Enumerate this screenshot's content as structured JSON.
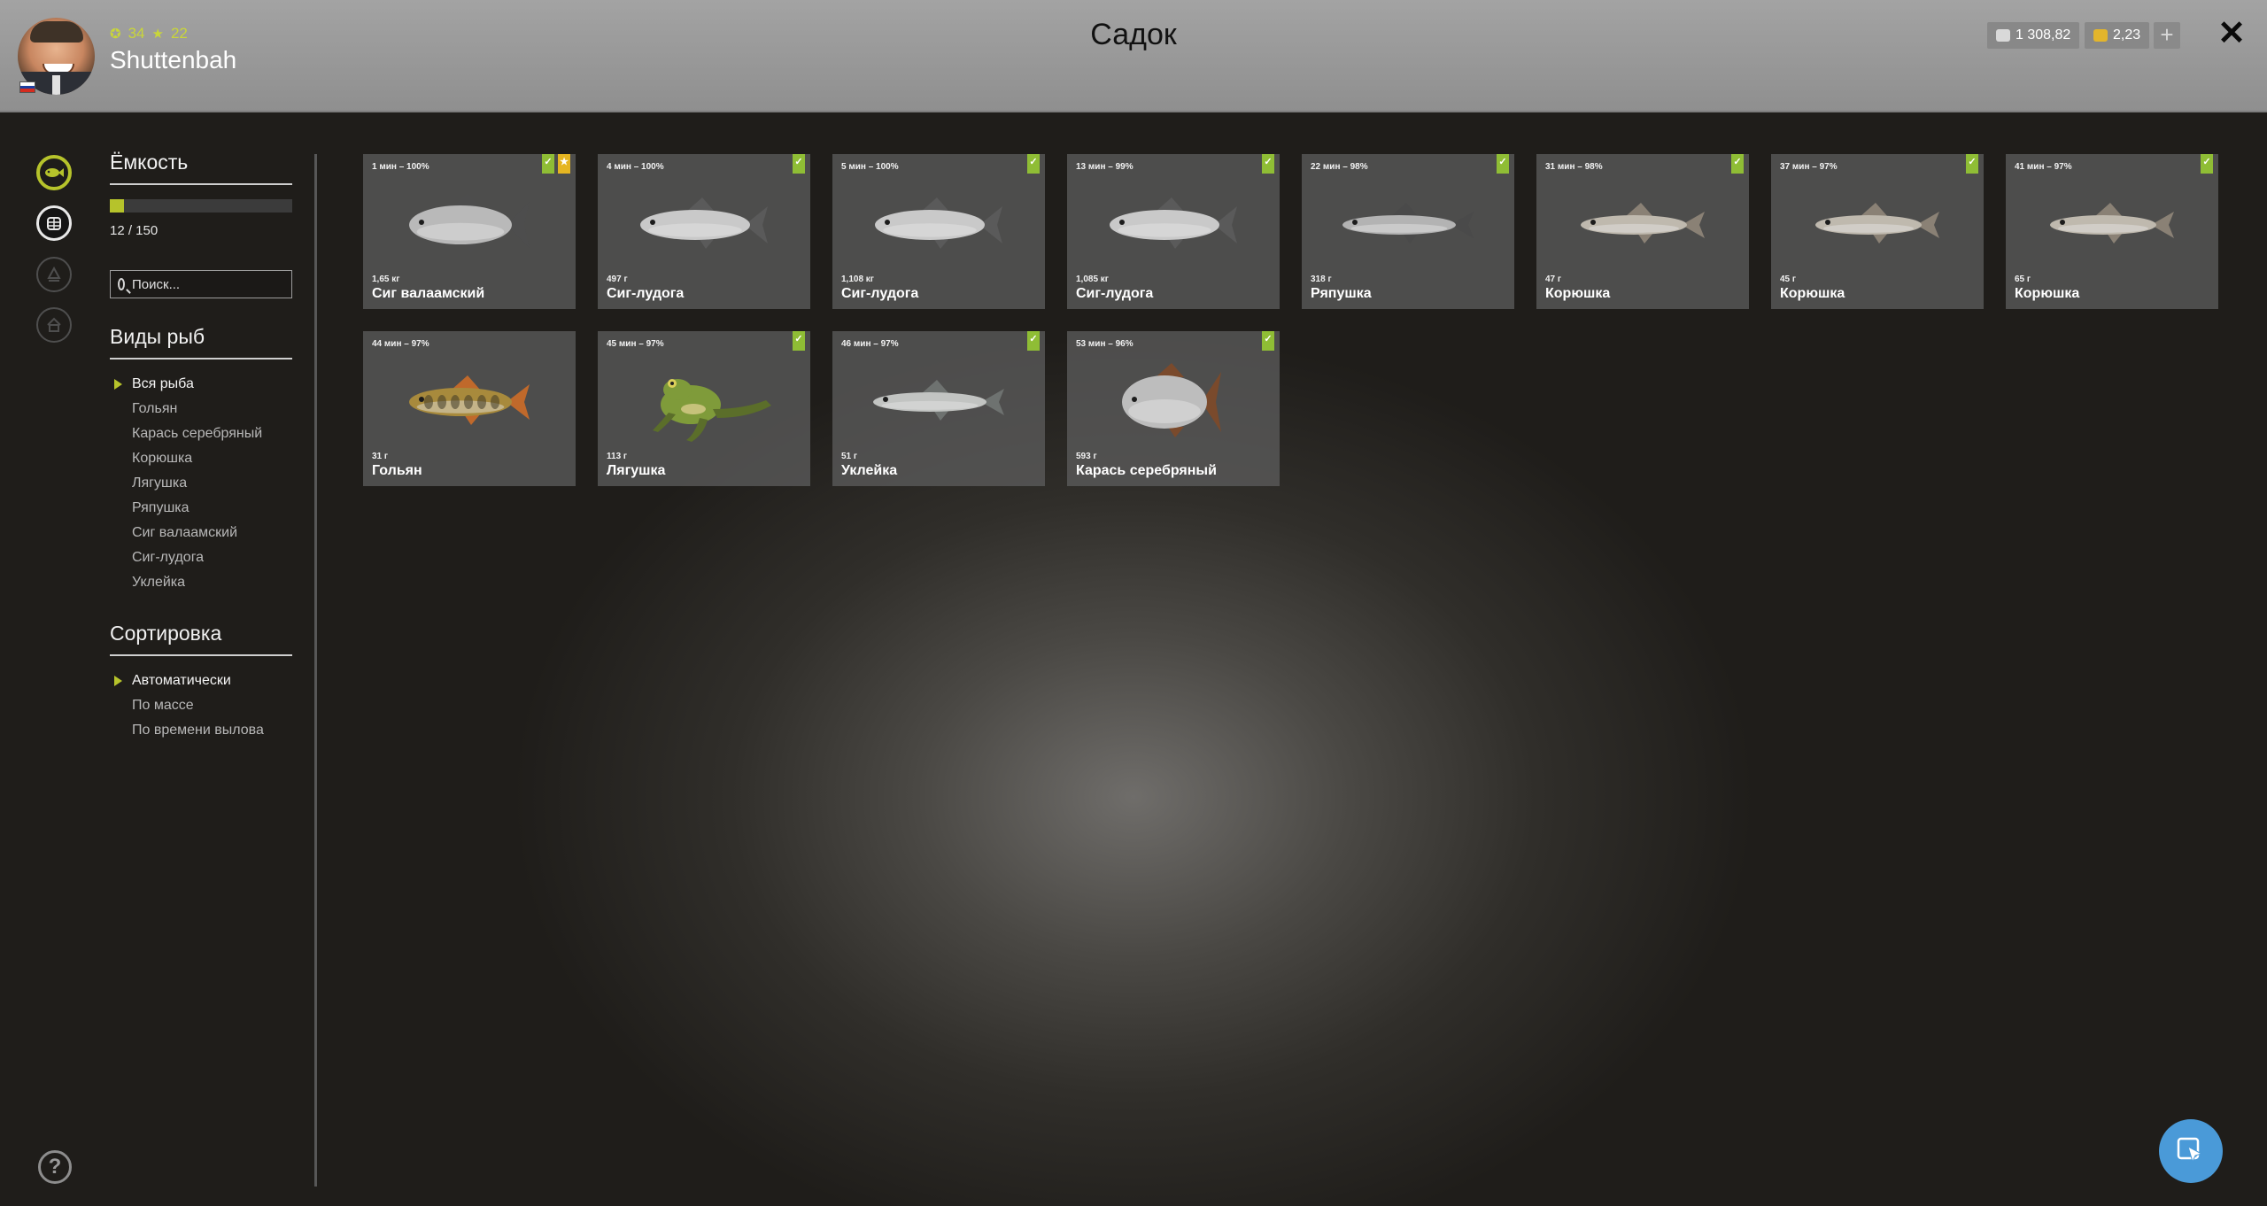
{
  "header": {
    "title": "Садок",
    "player": {
      "name": "Shuttenbah",
      "level": "34",
      "rank": "22"
    },
    "silver": "1 308,82",
    "gold": "2,23",
    "add_label": "+",
    "close_label": "✕"
  },
  "sidebar": {
    "capacity_heading": "Ёмкость",
    "capacity_text": "12 / 150",
    "capacity_fraction": 0.08,
    "search_placeholder": "Поиск...",
    "species_heading": "Виды рыб",
    "species": [
      "Вся рыба",
      "Гольян",
      "Карась серебряный",
      "Корюшка",
      "Лягушка",
      "Ряпушка",
      "Сиг валаамский",
      "Сиг-лудога",
      "Уклейка"
    ],
    "species_selected": 0,
    "sort_heading": "Сортировка",
    "sort_options": [
      "Автоматически",
      "По массе",
      "По времени вылова"
    ],
    "sort_selected": 0
  },
  "help_label": "?",
  "colors": {
    "accent": "#b6c32b",
    "check_badge": "#8fbd35",
    "star_badge": "#e5b521"
  },
  "fish": [
    {
      "time": "1 мин – 100%",
      "weight": "1,65 кг",
      "name": "Сиг валаамский",
      "badges": [
        "check",
        "star"
      ],
      "kind": "whitefish-big",
      "body": "#b9b9b9",
      "fin": "#4d4d4d"
    },
    {
      "time": "4 мин – 100%",
      "weight": "497 г",
      "name": "Сиг-лудога",
      "badges": [
        "check"
      ],
      "kind": "whitefish",
      "body": "#c9c9c9",
      "fin": "#5a5a5a"
    },
    {
      "time": "5 мин – 100%",
      "weight": "1,108 кг",
      "name": "Сиг-лудога",
      "badges": [
        "check"
      ],
      "kind": "whitefish",
      "body": "#c9c9c9",
      "fin": "#5a5a5a"
    },
    {
      "time": "13 мин – 99%",
      "weight": "1,085 кг",
      "name": "Сиг-лудога",
      "badges": [
        "check"
      ],
      "kind": "whitefish",
      "body": "#c9c9c9",
      "fin": "#5a5a5a"
    },
    {
      "time": "22 мин – 98%",
      "weight": "318 г",
      "name": "Ряпушка",
      "badges": [
        "check"
      ],
      "kind": "slim",
      "body": "#b3b3b3",
      "fin": "#4a4a4a"
    },
    {
      "time": "31 мин – 98%",
      "weight": "47 г",
      "name": "Корюшка",
      "badges": [
        "check"
      ],
      "kind": "smelt",
      "body": "#bfb9ae",
      "fin": "#8a8175"
    },
    {
      "time": "37 мин – 97%",
      "weight": "45 г",
      "name": "Корюшка",
      "badges": [
        "check"
      ],
      "kind": "smelt",
      "body": "#bfb9ae",
      "fin": "#8a8175"
    },
    {
      "time": "41 мин – 97%",
      "weight": "65 г",
      "name": "Корюшка",
      "badges": [
        "check"
      ],
      "kind": "smelt",
      "body": "#bfb9ae",
      "fin": "#8a8175"
    },
    {
      "time": "44 мин – 97%",
      "weight": "31 г",
      "name": "Гольян",
      "badges": [],
      "kind": "minnow",
      "body": "#a88a3c",
      "fin": "#c0692b"
    },
    {
      "time": "45 мин – 97%",
      "weight": "113 г",
      "name": "Лягушка",
      "badges": [
        "check"
      ],
      "kind": "frog",
      "body": "#7f9b3a",
      "fin": "#5b6e2a"
    },
    {
      "time": "46 мин – 97%",
      "weight": "51 г",
      "name": "Уклейка",
      "badges": [
        "check"
      ],
      "kind": "slim",
      "body": "#c2c4c2",
      "fin": "#6e7270"
    },
    {
      "time": "53 мин – 96%",
      "weight": "593 г",
      "name": "Карась серебряный",
      "badges": [
        "check"
      ],
      "kind": "crucian",
      "body": "#bdbdbd",
      "fin": "#7a4a2c"
    }
  ]
}
